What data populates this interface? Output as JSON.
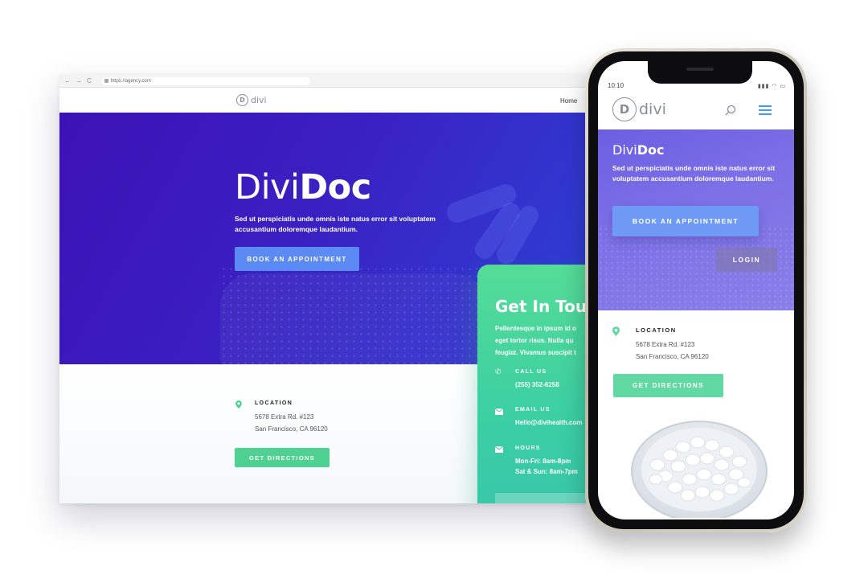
{
  "browser": {
    "url": "https://agency.com",
    "nav_glyphs": [
      "←",
      "→",
      "C"
    ]
  },
  "site": {
    "logo_mark": "D",
    "logo_text": "divi",
    "nav_home": "Home"
  },
  "hero": {
    "title_light": "Divi",
    "title_bold": "Doc",
    "text": "Sed ut perspiciatis unde omnis iste natus error sit voluptatem accusantium doloremque laudantium.",
    "book_button": "BOOK AN APPOINTMENT"
  },
  "location": {
    "label": "LOCATION",
    "line1": "5678 Extra Rd. #123",
    "line2": "San Francisco, CA 96120",
    "directions_button": "GET DIRECTIONS"
  },
  "contact": {
    "title": "Get In Touc",
    "text": "Pellentesque in ipsum id o\neget tortor risus. Nulla qu\nfeugiat. Vivamus suscipit t",
    "call_label": "CALL US",
    "call_value": "(255) 352-6258",
    "email_label": "EMAIL US",
    "email_value": "Hello@divihealth.com",
    "hours_label": "HOURS",
    "hours_line1": "Mon-Fri: 8am-8pm",
    "hours_line2": "Sat & Sun: 8am-7pm"
  },
  "phone": {
    "time": "10:10",
    "status": "▮▮▮ ◠ ▭",
    "title_light": "Divi",
    "title_bold": "Doc",
    "text": "Sed ut perspiciatis unde omnis iste natus error sit voluptatem accusantium doloremque laudantium.",
    "book_button": "BOOK AN APPOINTMENT",
    "login_button": "LOGIN",
    "location_label": "LOCATION",
    "location_line1": "5678 Extra Rd. #123",
    "location_line2": "San Francisco, CA 96120",
    "directions_button": "GET DIRECTIONS"
  },
  "colors": {
    "hero_purple": "#3c12b6",
    "accent_blue": "#5b8af4",
    "accent_green": "#4fd192",
    "menu_blue": "#3fa0e8"
  },
  "icons": [
    "map-pin-icon",
    "phone-icon",
    "mail-icon",
    "search-icon",
    "hamburger-menu-icon",
    "lock-icon"
  ]
}
